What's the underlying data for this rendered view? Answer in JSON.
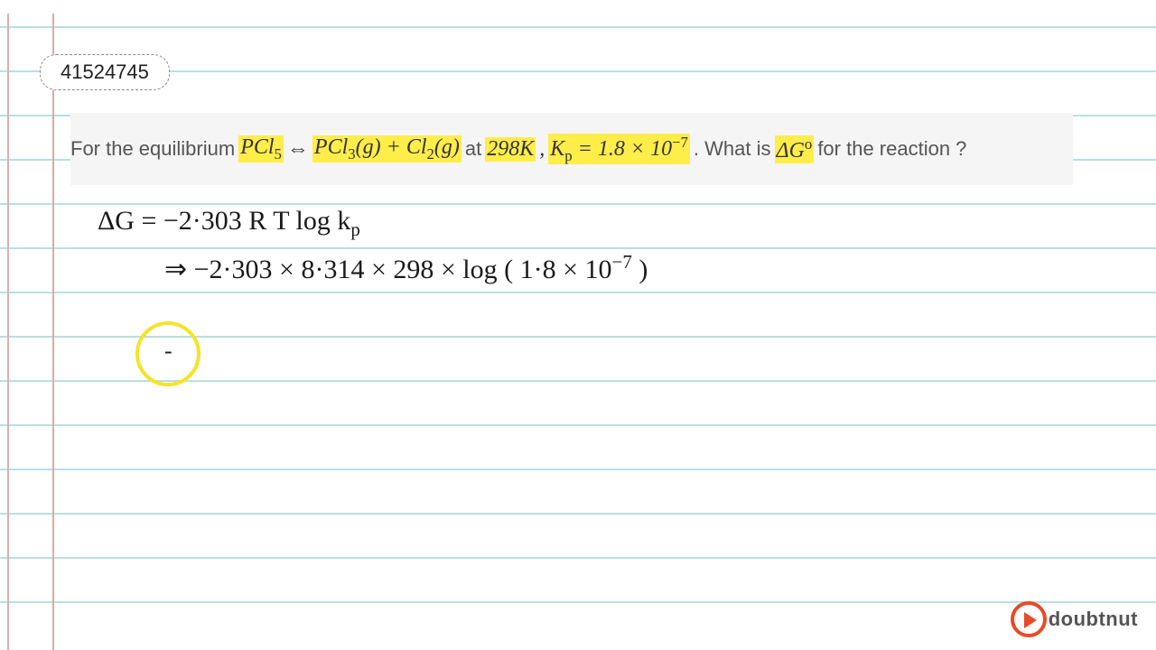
{
  "badge": {
    "number": "41524745"
  },
  "question": {
    "pre": "For the equilibrium ",
    "eq_compound1": "PCl",
    "eq_sub1": "5",
    "eq_arrow": " ⇔ ",
    "eq_compound2": "PCl",
    "eq_sub2": "3",
    "eq_state2": "(g) + Cl",
    "eq_sub3": "2",
    "eq_state3": "(g)",
    "mid1": " at ",
    "temp": "298K",
    "mid2": ", ",
    "kp_label": "K",
    "kp_sub": "p",
    "kp_eq": " = 1.8 × 10",
    "kp_exp": "−7",
    "mid3": ". What is ",
    "dg": "ΔG",
    "dg_sup": "o",
    "post": " for the reaction ?"
  },
  "handwritten": {
    "line1": "ΔG =  −2·303  R T  log  k",
    "line1_sub": "p",
    "line2_arrow": "⇒",
    "line2": "  −2·303 × 8·314 × 298  ×  log ( 1·8 × 10",
    "line2_exp": "−7",
    "line2_close": " )"
  },
  "logo": {
    "text": "doubtnut"
  }
}
